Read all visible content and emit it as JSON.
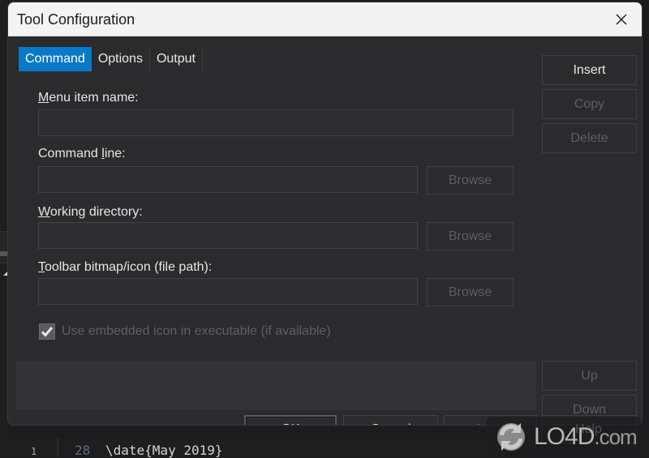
{
  "window": {
    "title": "Tool Configuration",
    "close_label": "×"
  },
  "tabs": [
    {
      "label": "Command",
      "active": true
    },
    {
      "label": "Options",
      "active": false
    },
    {
      "label": "Output",
      "active": false
    }
  ],
  "form": {
    "menu_item_name": {
      "label_u": "M",
      "label_rest": "enu item name:",
      "value": ""
    },
    "command_line": {
      "label_pre": "Command ",
      "label_u": "l",
      "label_rest": "ine:",
      "value": ""
    },
    "working_directory": {
      "label_u": "W",
      "label_rest": "orking directory:",
      "value": ""
    },
    "toolbar_icon": {
      "label_u": "T",
      "label_rest": "oolbar bitmap/icon (file path):",
      "value": ""
    },
    "browse_label": "Browse",
    "use_embedded_icon": {
      "label": "Use embedded icon in executable (if available)",
      "checked": true,
      "enabled": false
    }
  },
  "side_buttons": {
    "insert": "Insert",
    "copy": "Copy",
    "delete": "Delete",
    "up": "Up",
    "down": "Down",
    "help": "Help"
  },
  "footer_buttons": {
    "ok": "OK",
    "cancel": "Cancel",
    "apply": "Apply"
  },
  "background": {
    "line_number": "28",
    "code_text": "\\date{May 2019}",
    "gutter_num": "1"
  },
  "watermark": {
    "brand": "LO4D",
    "suffix": ".com"
  },
  "colors": {
    "accent": "#0a79c8",
    "dialog_bg": "#2b2b2e",
    "titlebar_bg": "#f3f3f3"
  }
}
